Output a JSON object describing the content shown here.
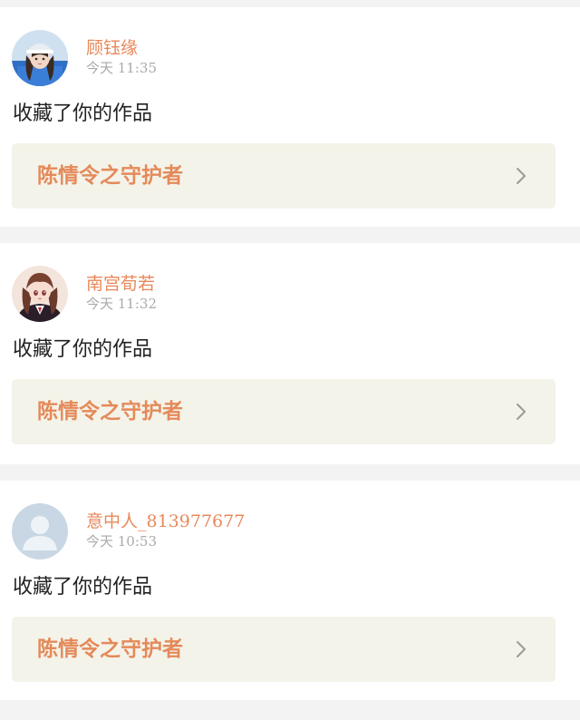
{
  "notifications": [
    {
      "user_name": "顾钰缘",
      "time": "今天  11:35",
      "action": "收藏了你的作品",
      "work_title": "陈情令之守护者",
      "avatar": "avatar-girl-cap-blue"
    },
    {
      "user_name": "南宫荀若",
      "time": "今天  11:32",
      "action": "收藏了你的作品",
      "work_title": "陈情令之守护者",
      "avatar": "avatar-anime-girl-brown-hair"
    },
    {
      "user_name": "意中人_813977677",
      "time": "今天  10:53",
      "action": "收藏了你的作品",
      "work_title": "陈情令之守护者",
      "avatar": "avatar-default-silhouette"
    }
  ],
  "colors": {
    "accent": "#e8885a",
    "link_bg": "#f4f3e9",
    "divider_bg": "#f3f3f3",
    "time_gray": "#aaaaaa",
    "text_dark": "#222222"
  }
}
